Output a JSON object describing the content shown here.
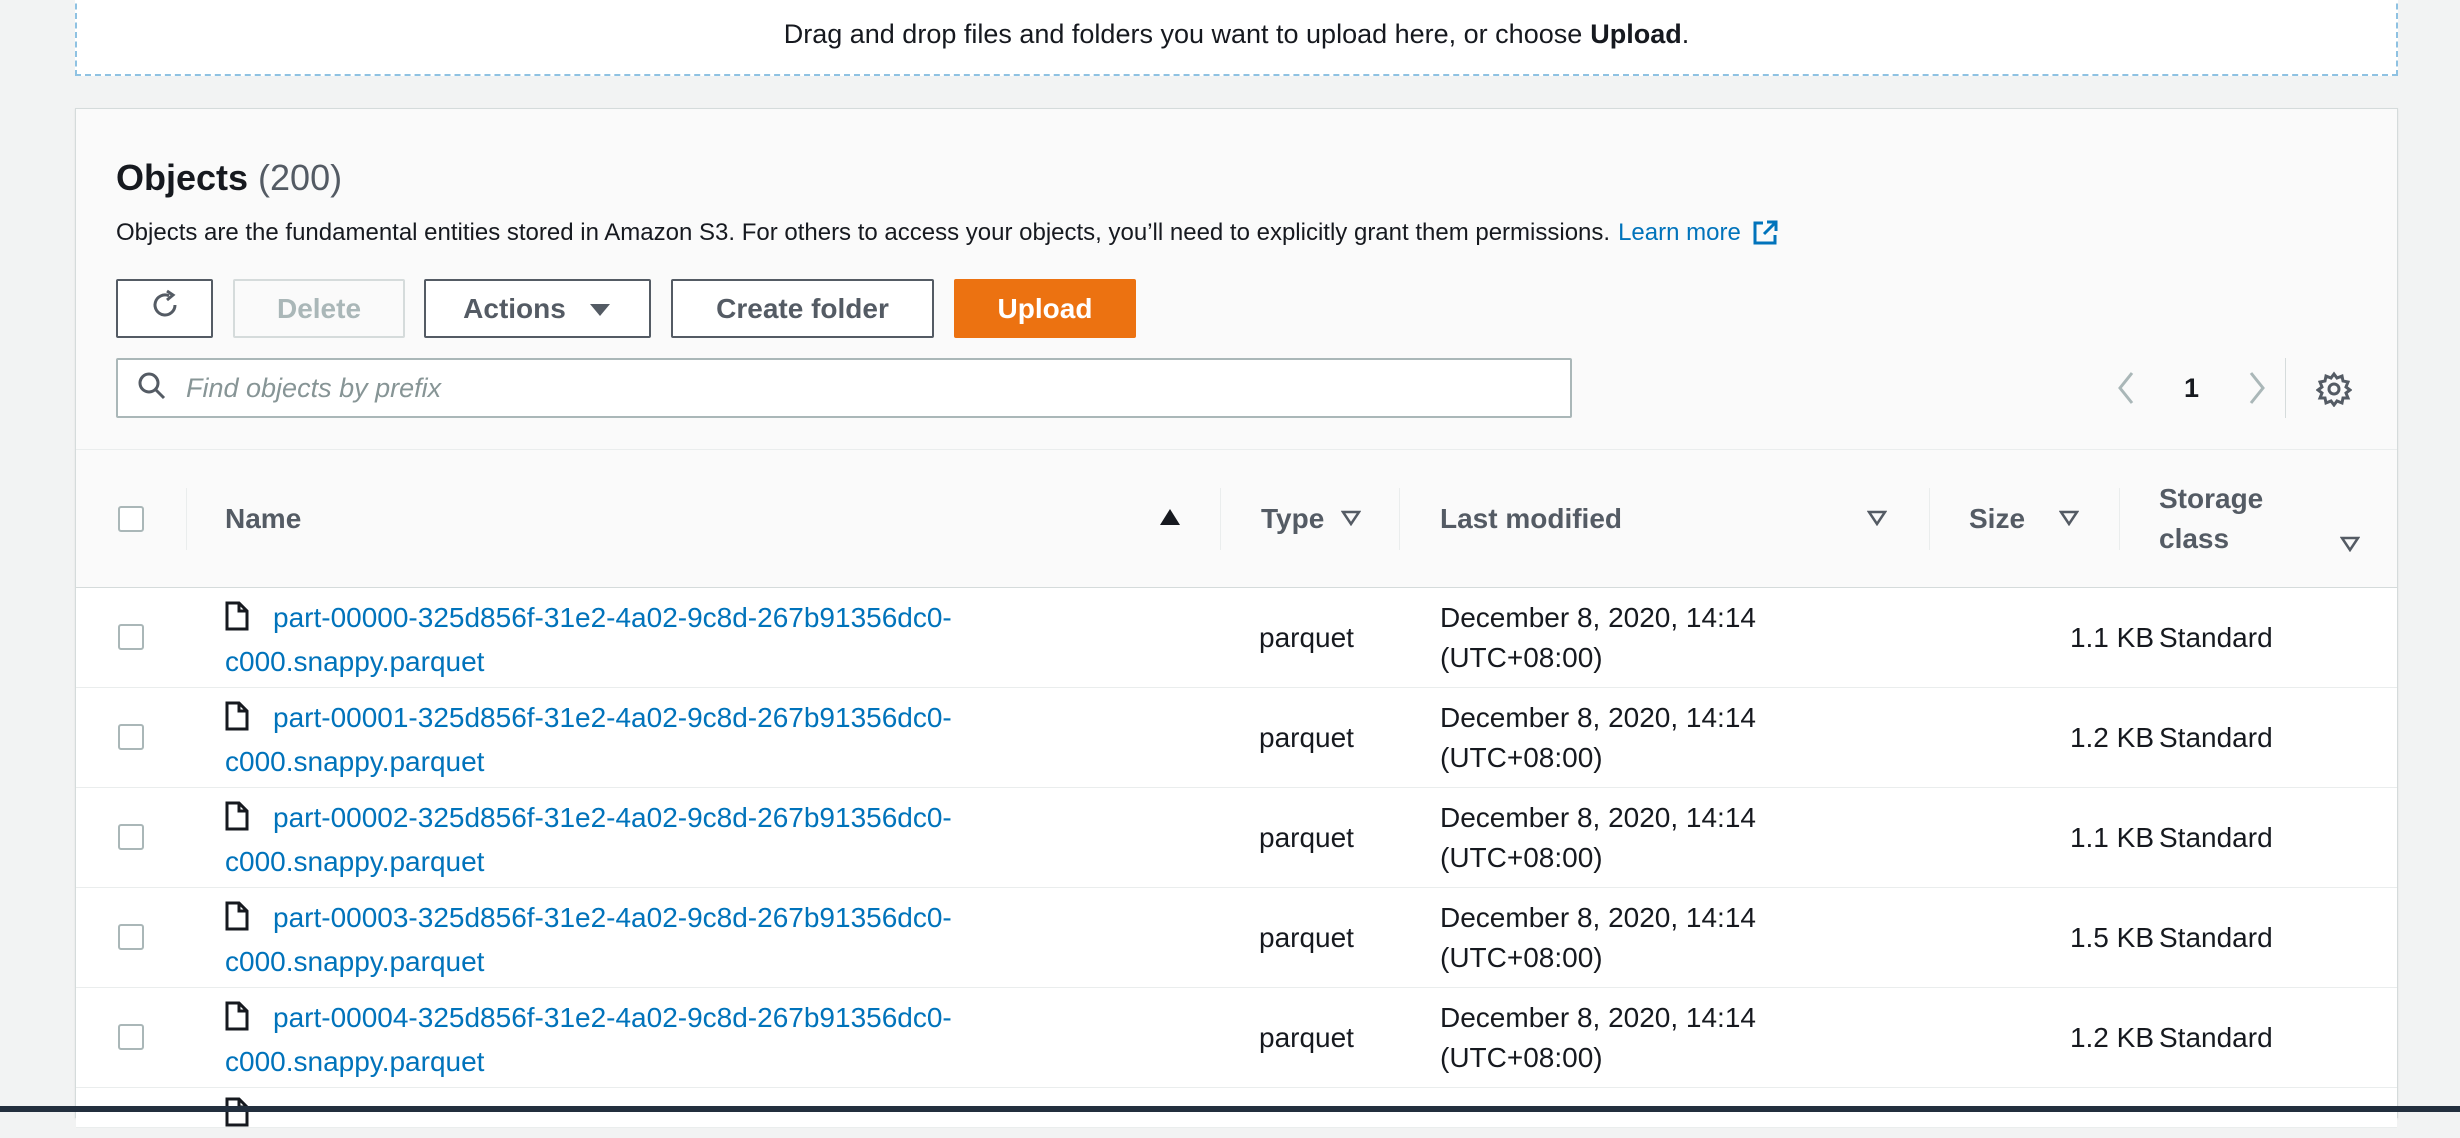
{
  "dropzone": {
    "text": "Drag and drop files and folders you want to upload here, or choose",
    "strong": "Upload",
    "period": "."
  },
  "objects": {
    "title": "Objects",
    "count": "(200)",
    "description": "Objects are the fundamental entities stored in Amazon S3. For others to access your objects, you’ll need to explicitly grant them permissions.",
    "learn_more": "Learn more"
  },
  "toolbar": {
    "delete_label": "Delete",
    "actions_label": "Actions",
    "create_folder_label": "Create folder",
    "upload_label": "Upload"
  },
  "search": {
    "placeholder": "Find objects by prefix"
  },
  "pagination": {
    "current_page": "1"
  },
  "table": {
    "headers": {
      "name": "Name",
      "type": "Type",
      "last_modified": "Last modified",
      "size": "Size",
      "storage_class_line1": "Storage",
      "storage_class_line2": "class"
    },
    "rows": [
      {
        "name_line1": "part-00000-325d856f-31e2-4a02-9c8d-267b91356dc0-",
        "name_line2": "c000.snappy.parquet",
        "type": "parquet",
        "date_line1": "December 8, 2020, 14:14",
        "date_line2": "(UTC+08:00)",
        "size": "1.1 KB",
        "storage": "Standard"
      },
      {
        "name_line1": "part-00001-325d856f-31e2-4a02-9c8d-267b91356dc0-",
        "name_line2": "c000.snappy.parquet",
        "type": "parquet",
        "date_line1": "December 8, 2020, 14:14",
        "date_line2": "(UTC+08:00)",
        "size": "1.2 KB",
        "storage": "Standard"
      },
      {
        "name_line1": "part-00002-325d856f-31e2-4a02-9c8d-267b91356dc0-",
        "name_line2": "c000.snappy.parquet",
        "type": "parquet",
        "date_line1": "December 8, 2020, 14:14",
        "date_line2": "(UTC+08:00)",
        "size": "1.1 KB",
        "storage": "Standard"
      },
      {
        "name_line1": "part-00003-325d856f-31e2-4a02-9c8d-267b91356dc0-",
        "name_line2": "c000.snappy.parquet",
        "type": "parquet",
        "date_line1": "December 8, 2020, 14:14",
        "date_line2": "(UTC+08:00)",
        "size": "1.5 KB",
        "storage": "Standard"
      },
      {
        "name_line1": "part-00004-325d856f-31e2-4a02-9c8d-267b91356dc0-",
        "name_line2": "c000.snappy.parquet",
        "type": "parquet",
        "date_line1": "December 8, 2020, 14:14",
        "date_line2": "(UTC+08:00)",
        "size": "1.2 KB",
        "storage": "Standard"
      }
    ]
  },
  "colors": {
    "link": "#0073bb",
    "upload_button": "#ec7211",
    "dropzone_border": "#8fc2e2",
    "text_secondary": "#545b64"
  },
  "icons": {
    "refresh": "refresh-icon",
    "actions_dropdown": "caret-down-icon",
    "search": "search-icon",
    "prev": "chevron-left-icon",
    "next": "chevron-right-icon",
    "settings": "gear-icon",
    "external": "external-link-icon",
    "file": "file-icon",
    "sort_asc": "sort-ascending-icon",
    "sort": "sort-icon"
  }
}
